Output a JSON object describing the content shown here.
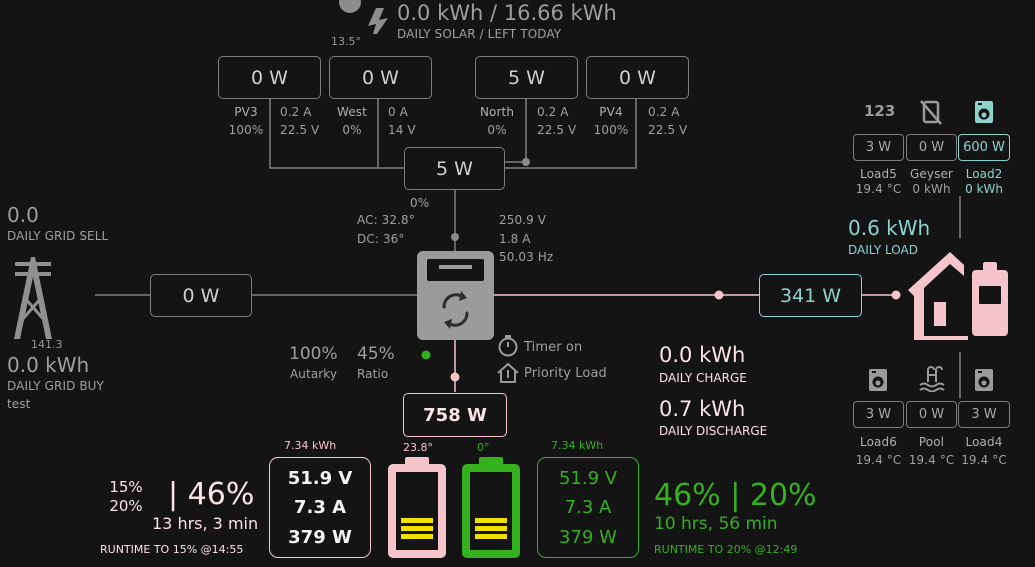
{
  "colors": {
    "pink": "#f6c5cc",
    "teal": "#8fd3cd",
    "green": "#35b01f",
    "grey": "#7d7d7d",
    "bg": "#141414"
  },
  "solar": {
    "temp": "13.5°",
    "daily": "0.0 kWh / 16.66 kWh",
    "daily_label": "DAILY SOLAR / LEFT TODAY",
    "total": "5 W",
    "total_pct": "0%",
    "strings": [
      {
        "power": "0 W",
        "name": "PV3",
        "pct": "100%",
        "amps": "0.2 A",
        "volts": "22.5 V"
      },
      {
        "power": "0 W",
        "name": "West",
        "pct": "0%",
        "amps": "0 A",
        "volts": "14 V"
      },
      {
        "power": "5 W",
        "name": "North",
        "pct": "0%",
        "amps": "0.2 A",
        "volts": "22.5 V"
      },
      {
        "power": "0 W",
        "name": "PV4",
        "pct": "100%",
        "amps": "0.2 A",
        "volts": "22.5 V"
      }
    ]
  },
  "inverter": {
    "ac_temp": "AC: 32.8°",
    "dc_temp": "DC: 36°",
    "voltage": "250.9 V",
    "current": "1.8 A",
    "frequency": "50.03 Hz",
    "autarky_value": "100%",
    "autarky_label": "Autarky",
    "ratio_value": "45%",
    "ratio_label": "Ratio",
    "timer_label": "Timer on",
    "priority_label": "Priority Load"
  },
  "grid": {
    "sell_value": "0.0",
    "sell_label": "DAILY GRID SELL",
    "power": "0 W",
    "voltage": "141.3",
    "buy_value": "0.0 kWh",
    "buy_label": "DAILY GRID BUY",
    "extra": "test"
  },
  "load": {
    "power": "341 W",
    "daily_value": "0.6 kWh",
    "daily_label": "DAILY LOAD",
    "top": [
      {
        "icon": "123-icon",
        "power": "3 W",
        "name": "Load5",
        "sub": "19.4 °C"
      },
      {
        "icon": "geyser-off-icon",
        "power": "0 W",
        "name": "Geyser",
        "sub": "0 kWh"
      },
      {
        "icon": "washer-icon",
        "power": "600 W",
        "name": "Load2",
        "sub": "0 kWh"
      }
    ],
    "bottom": [
      {
        "icon": "washer-icon",
        "power": "3 W",
        "name": "Load6",
        "sub": "19.4 °C"
      },
      {
        "icon": "pool-icon",
        "power": "0 W",
        "name": "Pool",
        "sub": "19.4 °C"
      },
      {
        "icon": "washer-icon",
        "power": "3 W",
        "name": "Load4",
        "sub": "19.4 °C"
      }
    ],
    "icon_123": "123"
  },
  "battery": {
    "power": "758 W",
    "daily_charge_value": "0.0 kWh",
    "daily_charge_label": "DAILY CHARGE",
    "daily_discharge_value": "0.7 kWh",
    "daily_discharge_label": "DAILY DISCHARGE",
    "b1": {
      "capacity": "7.34 kWh",
      "voltage": "51.9 V",
      "current": "7.3 A",
      "power": "379 W",
      "temp": "23.8°",
      "soc_lines": [
        "15%",
        "20%"
      ],
      "soc": "| 46%",
      "runtime": "13 hrs, 3 min",
      "runtime_label": "RUNTIME TO 15% @14:55"
    },
    "b2": {
      "capacity": "7.34 kWh",
      "voltage": "51.9 V",
      "current": "7.3 A",
      "power": "379 W",
      "temp": "0°",
      "soc": "46% | 20%",
      "runtime": "10 hrs, 56 min",
      "runtime_label": "RUNTIME TO 20% @12:49"
    }
  }
}
